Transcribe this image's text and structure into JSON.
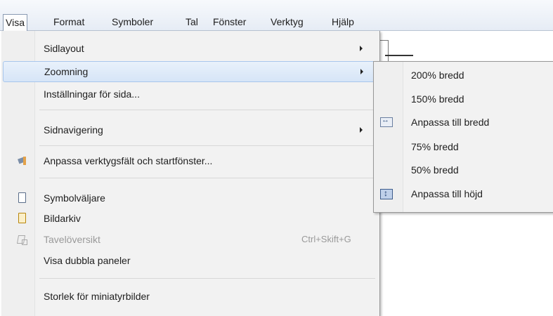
{
  "menubar": {
    "items": [
      {
        "label": "Visa"
      },
      {
        "label": "Format"
      },
      {
        "label": "Symboler"
      },
      {
        "label": "Tal"
      },
      {
        "label": "Fönster"
      },
      {
        "label": "Verktyg"
      },
      {
        "label": "Hjälp"
      }
    ]
  },
  "visa_menu": {
    "items": [
      {
        "label": "Sidlayout",
        "submenu": true
      },
      {
        "label": "Zoomning",
        "submenu": true,
        "highlighted": true
      },
      {
        "label": "Inställningar för sida..."
      },
      {
        "label": "Sidnavigering",
        "submenu": true
      },
      {
        "label": "Anpassa verktygsfält och startfönster...",
        "icon": "toolbar-customize-icon"
      },
      {
        "label": "Symbolväljare",
        "icon": "document-icon"
      },
      {
        "label": "Bildarkiv",
        "icon": "document-gold-icon"
      },
      {
        "label": "Tavelöversikt",
        "shortcut": "Ctrl+Skift+G",
        "disabled": true,
        "icon": "board-overview-icon"
      },
      {
        "label": "Visa dubbla paneler"
      },
      {
        "label": "Storlek för miniatyrbilder"
      }
    ]
  },
  "zoom_submenu": {
    "items": [
      {
        "label": "200% bredd"
      },
      {
        "label": "150% bredd"
      },
      {
        "label": "Anpassa till bredd",
        "icon": "fit-width-icon"
      },
      {
        "label": "75% bredd"
      },
      {
        "label": "50% bredd"
      },
      {
        "label": "Anpassa till höjd",
        "icon": "fit-height-icon"
      }
    ]
  },
  "colors": {
    "highlight": "#d6e5f7",
    "highlight_border": "#a8c6ec",
    "menu_bg": "#f2f2f2",
    "disabled_text": "#9a9a9a"
  }
}
